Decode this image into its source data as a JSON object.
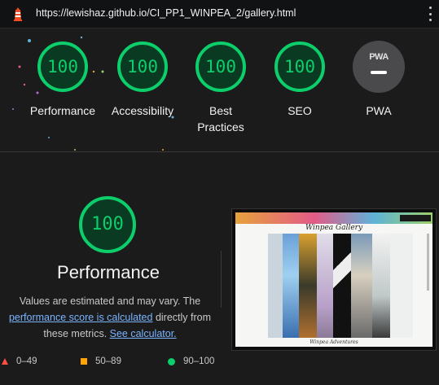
{
  "browser": {
    "url": "https://lewishaz.github.io/CI_PP1_WINPEA_2/gallery.html"
  },
  "colors": {
    "pass": "#0cce6b",
    "average": "#ffa400",
    "fail": "#ff4e42",
    "background": "#1b1b1c",
    "link": "#7ab4ff"
  },
  "gauges": [
    {
      "score": "100",
      "label": "Performance"
    },
    {
      "score": "100",
      "label": "Accessibility"
    },
    {
      "score": "100",
      "label": "Best Practices"
    },
    {
      "score": "100",
      "label": "SEO"
    }
  ],
  "pwa": {
    "badge": "PWA",
    "label": "PWA"
  },
  "performance": {
    "score": "100",
    "title": "Performance",
    "desc_prefix": "Values are estimated and may vary. The ",
    "score_link": "performance score is calculated",
    "desc_middle": " directly from these metrics. ",
    "calc_link": "See calculator."
  },
  "screenshot": {
    "site_title": "Winpea Gallery",
    "footer_text": "Winpea Adventures"
  },
  "legend": [
    {
      "range": "0–49",
      "icon": "fail-triangle-icon"
    },
    {
      "range": "50–89",
      "icon": "average-square-icon"
    },
    {
      "range": "90–100",
      "icon": "pass-circle-icon"
    }
  ]
}
